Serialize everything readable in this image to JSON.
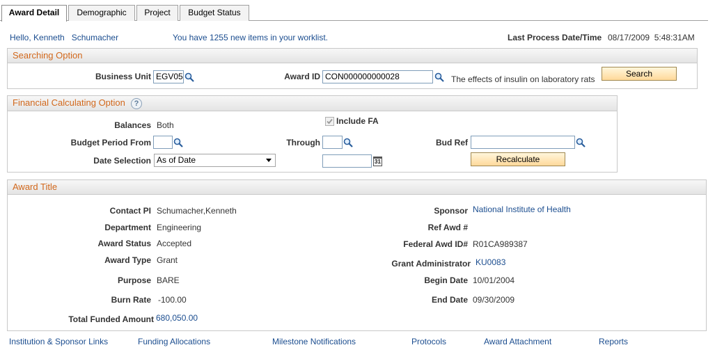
{
  "tabs": [
    {
      "label": "Award Detail",
      "active": true
    },
    {
      "label": "Demographic",
      "active": false
    },
    {
      "label": "Project",
      "active": false
    },
    {
      "label": "Budget Status",
      "active": false
    }
  ],
  "header": {
    "greeting": "Hello, Kenneth   Schumacher",
    "worklist": "You have 1255 new items in your worklist.",
    "last_process_label": "Last Process Date/Time",
    "last_process_value": "08/17/2009  5:48:31AM"
  },
  "searching": {
    "title": "Searching Option",
    "business_unit_label": "Business Unit",
    "business_unit_value": "EGV05",
    "award_id_label": "Award ID",
    "award_id_value": "CON000000000028",
    "award_desc": "The effects of insulin on laboratory rats",
    "search_button": "Search"
  },
  "financial": {
    "title": "Financial Calculating Option",
    "help_icon": "?",
    "include_fa_label": "Include FA",
    "include_fa_checked": true,
    "balances_label": "Balances",
    "balances_value": "Both",
    "budget_period_from_label": "Budget Period From",
    "budget_period_from_value": "",
    "through_label": "Through",
    "through_value": "",
    "bud_ref_label": "Bud Ref",
    "bud_ref_value": "",
    "date_selection_label": "Date Selection",
    "date_selection_value": "As of Date",
    "date_value": "",
    "calendar_icon_text": "31",
    "recalculate_button": "Recalculate"
  },
  "award": {
    "title": "Award Title",
    "contact_pi_label": "Contact PI",
    "contact_pi_value": "Schumacher,Kenneth",
    "department_label": "Department",
    "department_value": "Engineering",
    "award_status_label": "Award Status",
    "award_status_value": "Accepted",
    "award_type_label": "Award Type",
    "award_type_value": "Grant",
    "purpose_label": "Purpose",
    "purpose_value": "BARE",
    "burn_rate_label": "Burn Rate",
    "burn_rate_value": "-100.00",
    "total_funded_label": "Total Funded Amount",
    "total_funded_value": "680,050.00",
    "sponsor_label": "Sponsor",
    "sponsor_value": "National Institute of Health",
    "ref_awd_label": "Ref Awd #",
    "ref_awd_value": "",
    "federal_awd_label": "Federal Awd ID#",
    "federal_awd_value": "R01CA989387",
    "grant_admin_label": "Grant Administrator",
    "grant_admin_value": "KU0083",
    "begin_date_label": "Begin Date",
    "begin_date_value": "10/01/2004",
    "end_date_label": "End Date",
    "end_date_value": "09/30/2009"
  },
  "footer_links": [
    "Institution & Sponsor Links",
    "Funding Allocations",
    "Milestone Notifications",
    "Protocols",
    "Award Attachment",
    "Reports"
  ],
  "colors": {
    "link": "#1b4d8f",
    "section_title": "#d2681c",
    "button_top": "#fff6dc",
    "button_bottom": "#ffd99a"
  },
  "icons": {
    "lookup": "magnifier-icon",
    "calendar": "calendar-icon",
    "help": "help-icon",
    "dropdown": "dropdown-arrow-icon"
  }
}
